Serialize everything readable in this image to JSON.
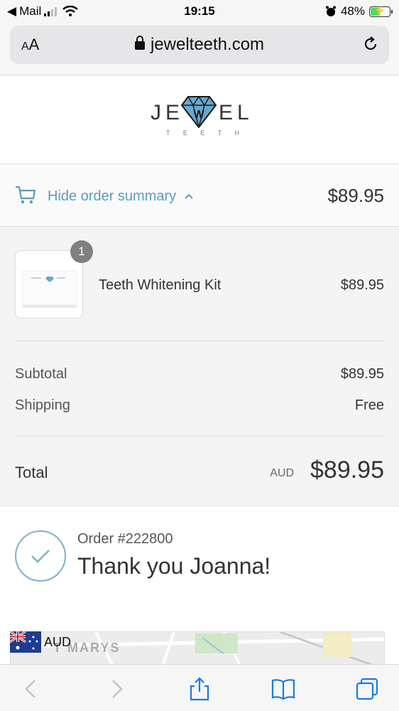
{
  "status_bar": {
    "back_app": "Mail",
    "time": "19:15",
    "battery": "48%",
    "battery_level": 0.48
  },
  "browser": {
    "text_size_label": "AA",
    "url": "jewelteeth.com"
  },
  "logo": {
    "word_left": "JE",
    "word_right": "EL",
    "tagline": "T E E T H"
  },
  "summary_toggle": {
    "label": "Hide order summary",
    "total": "$89.95"
  },
  "line_items": [
    {
      "quantity": "1",
      "name": "Teeth Whitening Kit",
      "price": "$89.95"
    }
  ],
  "totals": {
    "subtotal_label": "Subtotal",
    "subtotal_value": "$89.95",
    "shipping_label": "Shipping",
    "shipping_value": "Free",
    "total_label": "Total",
    "currency": "AUD",
    "total_value": "$89.95"
  },
  "confirmation": {
    "order_number": "Order #222800",
    "message": "Thank you Joanna!"
  },
  "map": {
    "currency_chip": "AUD",
    "place_label": "T MARYS"
  },
  "colors": {
    "accent": "#5e9cb6",
    "diamond": "#6aa8cc"
  }
}
